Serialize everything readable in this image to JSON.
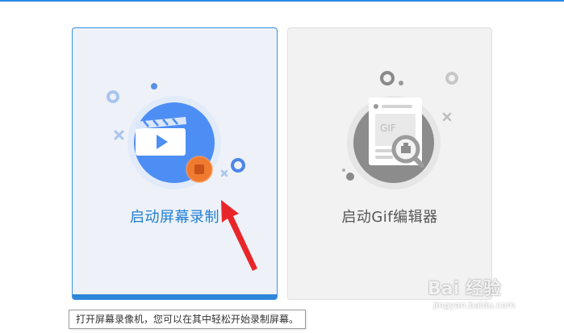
{
  "cards": {
    "record": {
      "label": "启动屏幕录制"
    },
    "gif": {
      "label": "启动Gif编辑器",
      "thumb_text": "GIF"
    }
  },
  "tooltip": {
    "text": "打开屏幕录像机，您可以在其中轻松开始录制屏幕。"
  },
  "watermark": {
    "brand": "Bai 经验",
    "site": "jingyan.baidu.com"
  },
  "colors": {
    "accent": "#2b8be0",
    "record_icon_blue": "#4d8ef5",
    "record_stop_orange": "#f07a2e",
    "gif_icon_gray": "#8c8c8c",
    "arrow_red": "#e8262a"
  },
  "icons": [
    "video-camera-icon",
    "stop-record-icon",
    "gif-editor-icon",
    "magnifier-icon",
    "annotation-arrow-icon"
  ]
}
